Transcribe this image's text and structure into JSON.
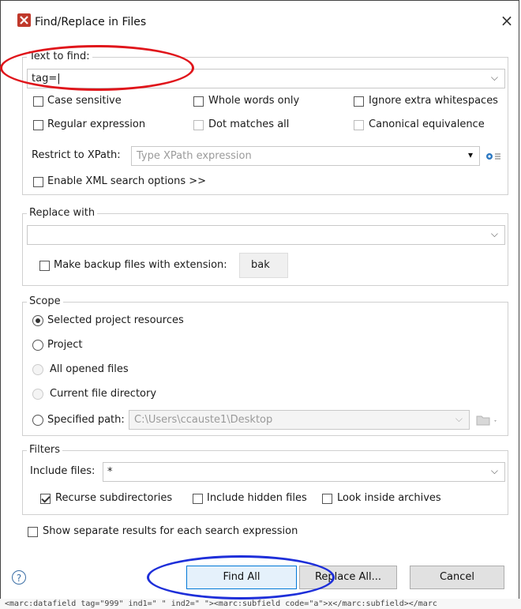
{
  "window": {
    "title": "Find/Replace in Files",
    "close_glyph": "×"
  },
  "find": {
    "legend": "Text to find:",
    "value": "tag=|",
    "case_sensitive": "Case sensitive",
    "whole_words": "Whole words only",
    "ignore_whitespace": "Ignore extra whitespaces",
    "regex": "Regular expression",
    "dot_matches": "Dot matches all",
    "canonical": "Canonical equivalence",
    "xpath_label": "Restrict to XPath:",
    "xpath_placeholder": "Type XPath expression",
    "xml_options": "Enable XML search options >>"
  },
  "replace": {
    "legend": "Replace with",
    "value": "",
    "backup_label": "Make backup files with extension:",
    "backup_ext": "bak"
  },
  "scope": {
    "legend": "Scope",
    "options": [
      "Selected project resources",
      "Project",
      "All opened files",
      "Current file directory",
      "Specified path:"
    ],
    "path_value": "C:\\Users\\ccauste1\\Desktop"
  },
  "filters": {
    "legend": "Filters",
    "include_label": "Include files:",
    "include_value": "*",
    "recurse": "Recurse subdirectories",
    "hidden": "Include hidden files",
    "archives": "Look inside archives"
  },
  "separate_results": "Show separate results for each search expression",
  "buttons": {
    "help": "?",
    "find_all": "Find All",
    "replace_all": "Replace All...",
    "cancel": "Cancel"
  },
  "editor_background_text": "<marc:datafield tag=\"999\" ind1=\" \" ind2=\" \"><marc:subfield code=\"a\">x</marc:subfield></marc",
  "annotation_colors": {
    "red": "#e0151b",
    "blue": "#1e2fd9"
  },
  "icons": {
    "app": "app-logo-icon",
    "close": "close-icon",
    "dropdown": "chevron-down-icon",
    "settings": "gear-icon",
    "folder": "folder-icon"
  }
}
